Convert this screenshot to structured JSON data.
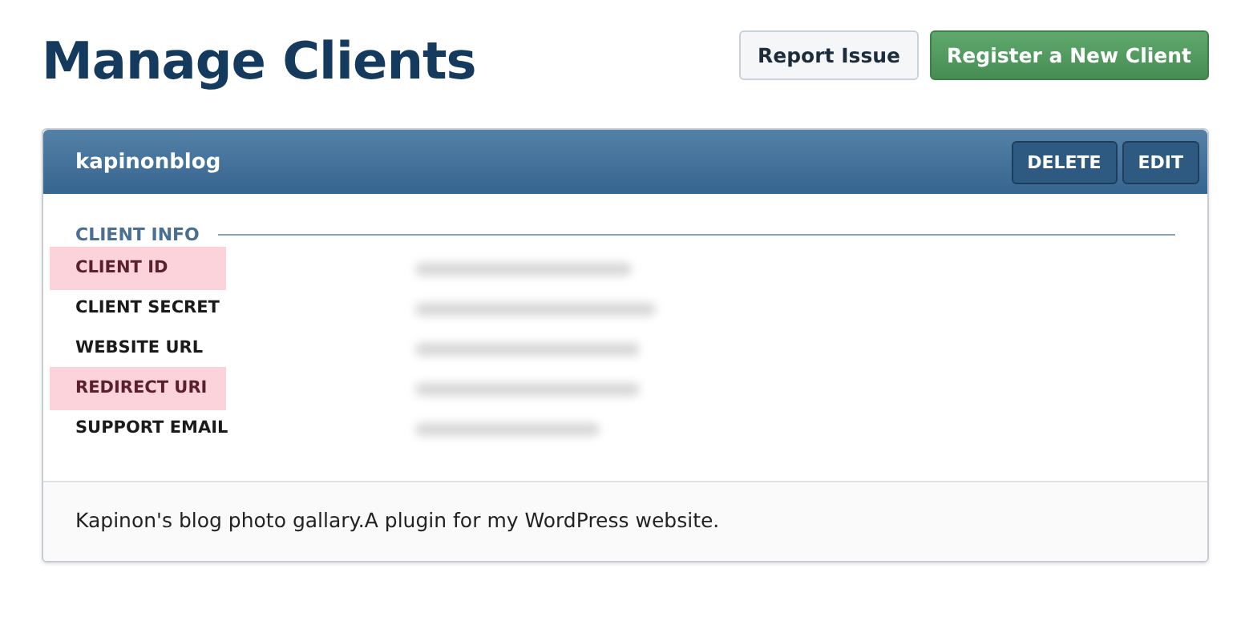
{
  "page_title": "Manage Clients",
  "header_buttons": [
    {
      "label": "Report Issue",
      "kind": "secondary"
    },
    {
      "label": "Register a New Client",
      "kind": "primary"
    }
  ],
  "client": {
    "name": "kapinonblog",
    "actions": [
      "DELETE",
      "EDIT"
    ],
    "section_title": "CLIENT INFO",
    "fields": [
      {
        "label": "CLIENT ID",
        "highlighted": true
      },
      {
        "label": "CLIENT SECRET",
        "highlighted": false
      },
      {
        "label": "WEBSITE URL",
        "highlighted": false
      },
      {
        "label": "REDIRECT URI",
        "highlighted": true
      },
      {
        "label": "SUPPORT EMAIL",
        "highlighted": false
      }
    ],
    "description": "Kapinon's blog photo gallary.A plugin for my WordPress website."
  }
}
